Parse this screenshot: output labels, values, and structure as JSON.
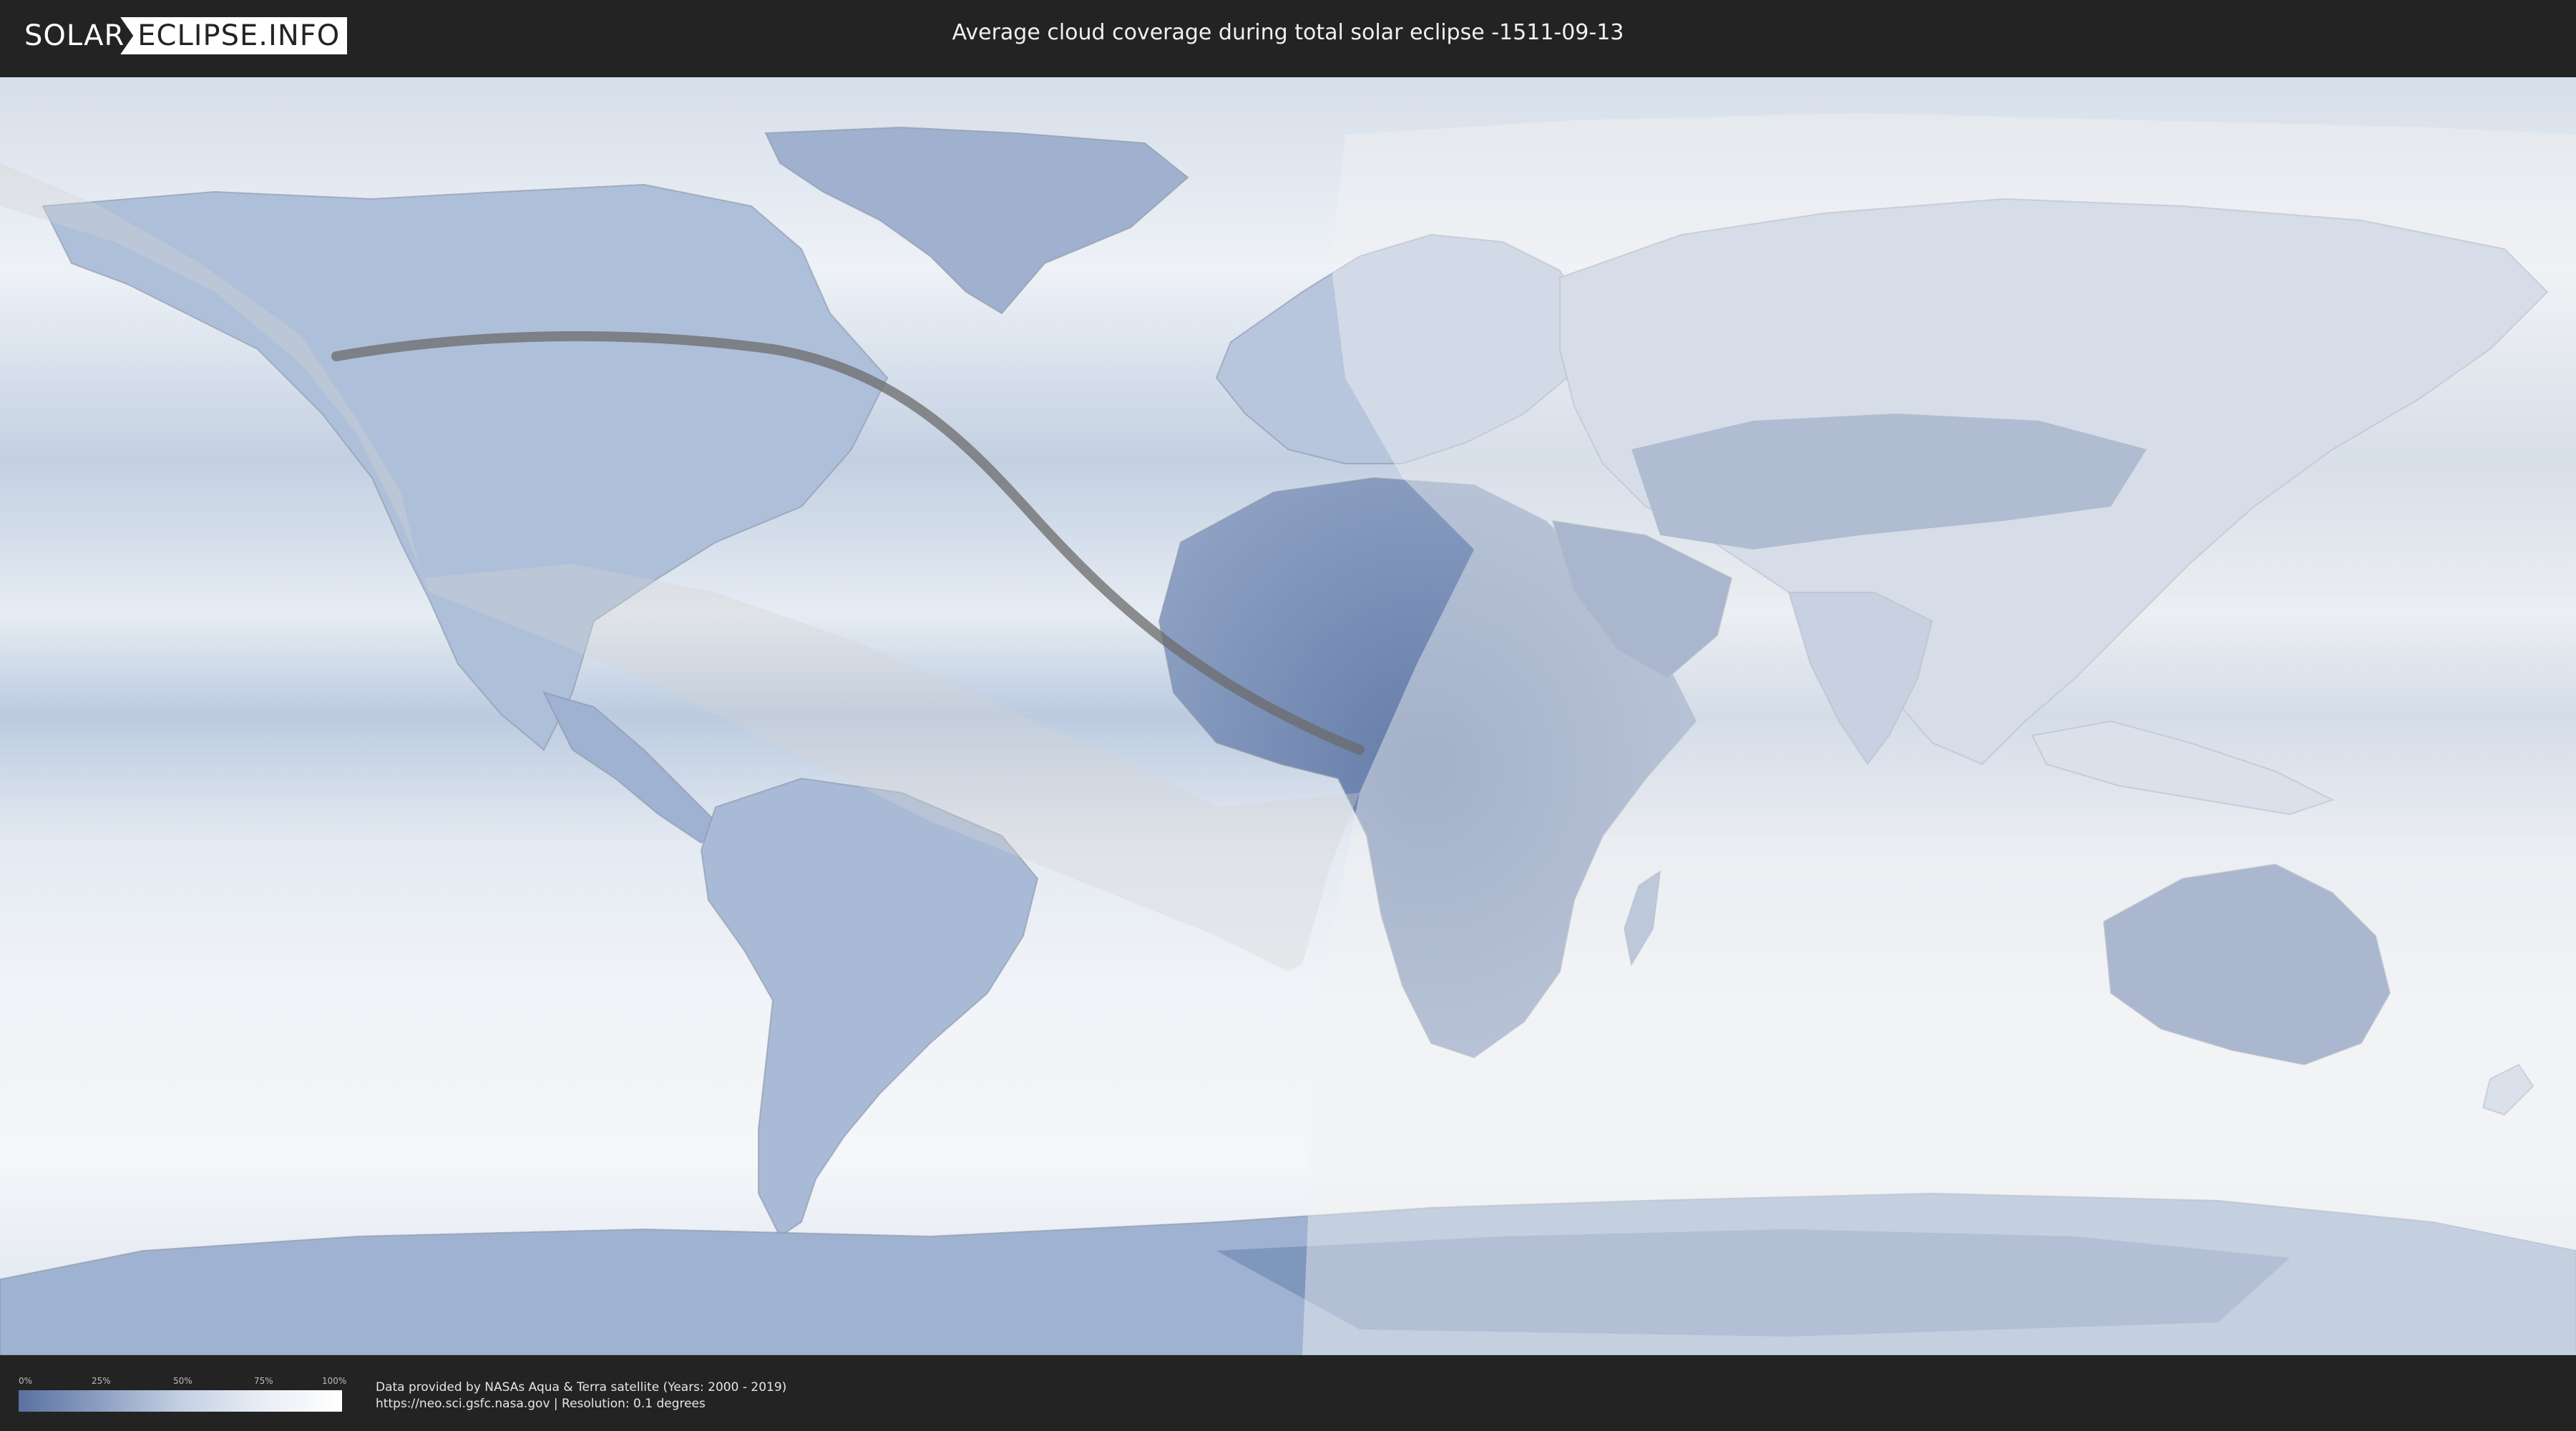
{
  "header": {
    "logo_left": "SOLAR",
    "logo_right": "ECLIPSE.INFO",
    "title": "Average cloud coverage during total solar eclipse -1511-09-13"
  },
  "legend": {
    "ticks": [
      "0%",
      "25%",
      "50%",
      "75%",
      "100%"
    ],
    "colors": {
      "low": "#5a72a2",
      "high": "#ffffff"
    }
  },
  "credits": {
    "line1": "Data provided by NASAs Aqua & Terra satellite (Years: 2000 - 2019)",
    "line2": "https://neo.sci.gsfc.nasa.gov | Resolution: 0.1 degrees"
  },
  "map": {
    "projection": "equirectangular",
    "colors": {
      "ocean": "#e9eef4",
      "cloud_free_land": "#6e86b3",
      "eclipse_path": "#6b6b6b",
      "visibility_zone": "#cfcfcf"
    }
  }
}
